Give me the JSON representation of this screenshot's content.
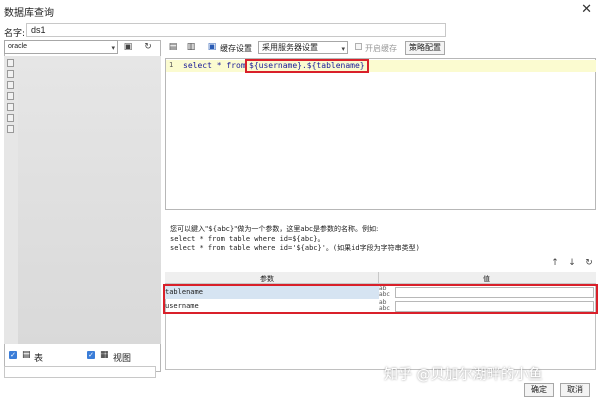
{
  "window": {
    "title": "数据库查询",
    "close_icon": "close-icon"
  },
  "name_field": {
    "label": "名字:",
    "value": "ds1"
  },
  "left_panel": {
    "connection": "oracle",
    "checkbox_table_label": "表",
    "checkbox_view_label": "视图"
  },
  "toolbar": {
    "cache_settings_label": "缓存设置",
    "server_setting_value": "采用服务器设置",
    "enable_cache_label": "开启缓存",
    "strategy_button": "策略配置"
  },
  "editor": {
    "line_number": "1",
    "code_prefix": "select * from ",
    "code_var": "${username}.${tablename}"
  },
  "hint": {
    "line1": "您可以鍵入\"${abc}\"做为一个参数，这里abc是参数的名称。例如:",
    "line2": "select * from table where id=${abc}。",
    "line3": "select * from table where id='${abc}'。(如果id字段为字符串类型)"
  },
  "params": {
    "col_param": "参数",
    "col_value": "值",
    "rows": [
      {
        "name": "tablename",
        "value": ""
      },
      {
        "name": "username",
        "value": ""
      }
    ]
  },
  "footer": {
    "ok": "确定",
    "cancel": "取消",
    "watermark": "知乎 @贝加尔湖畔的小鱼"
  }
}
